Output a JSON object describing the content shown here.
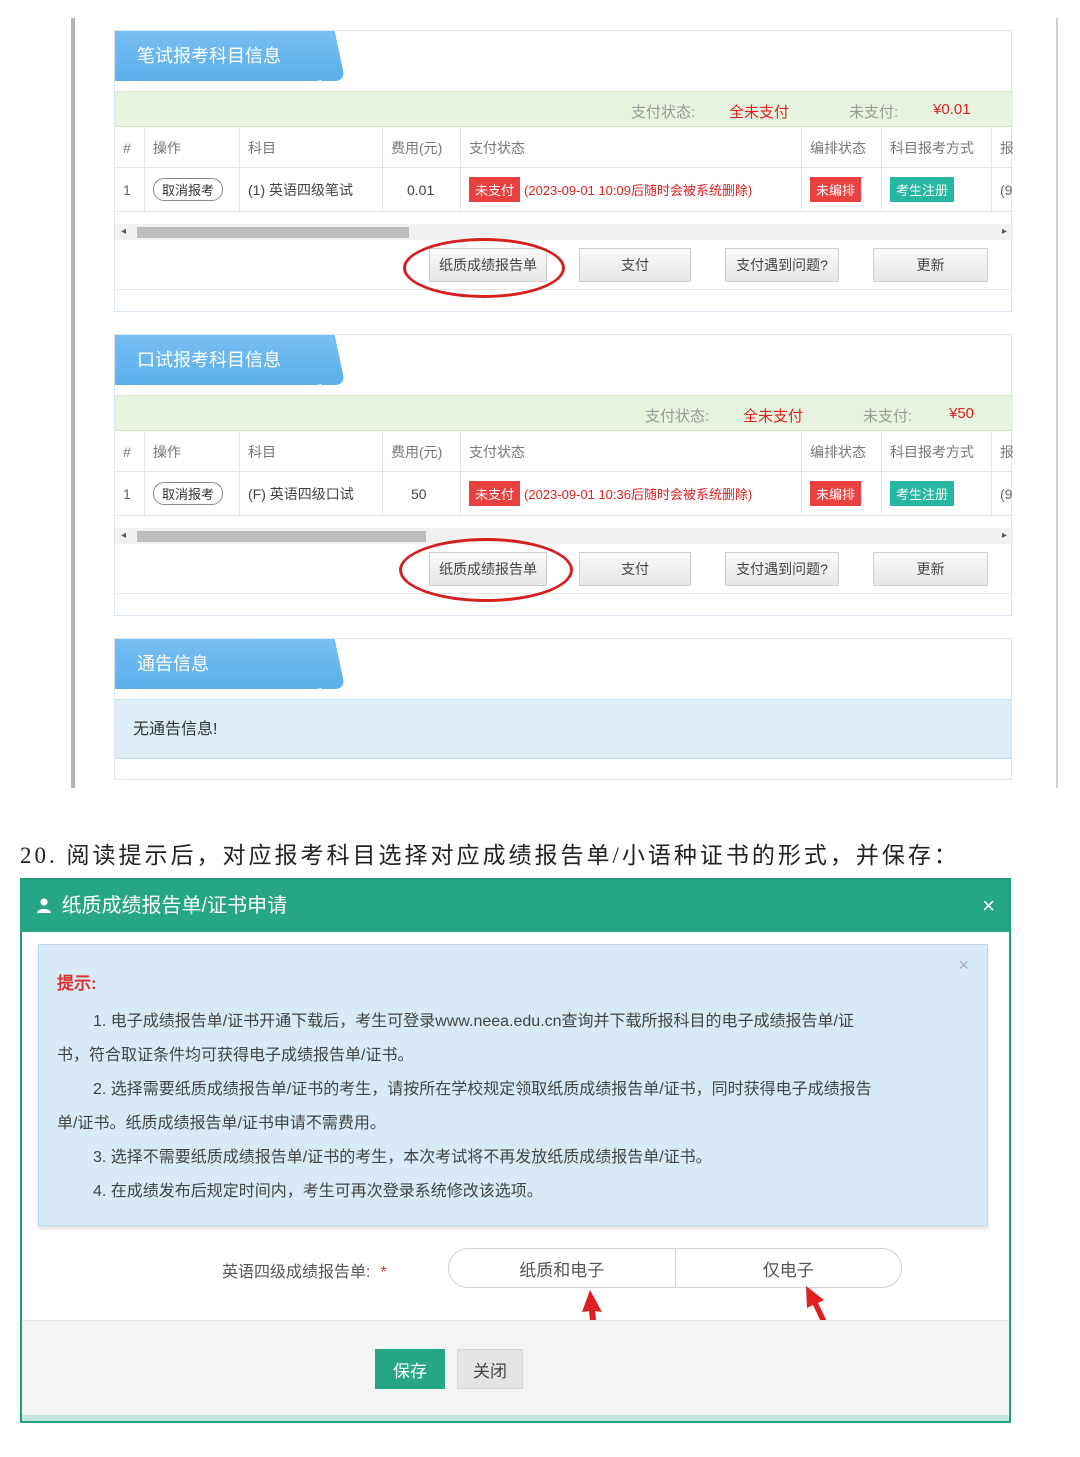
{
  "written_panel": {
    "title": "笔试报考科目信息",
    "pay_status_label": "支付状态:",
    "pay_status_value": "全未支付",
    "unpaid_label": "未支付:",
    "unpaid_value": "¥0.01",
    "columns": [
      "#",
      "操作",
      "科目",
      "费用(元)",
      "支付状态",
      "编排状态",
      "科目报考方式",
      "报"
    ],
    "row": {
      "index": "1",
      "action": "取消报考",
      "subject": "(1) 英语四级笔试",
      "fee": "0.01",
      "pay_tag": "未支付",
      "pay_note": "(2023-09-01 10:09后随时会被系统删除)",
      "arrange": "未编排",
      "mode": "考生注册",
      "extra": "(9"
    },
    "scroll_thumb_fraction": 0.31,
    "buttons": [
      "纸质成绩报告单",
      "支付",
      "支付遇到问题?",
      "更新"
    ]
  },
  "oral_panel": {
    "title": "口试报考科目信息",
    "pay_status_label": "支付状态:",
    "pay_status_value": "全未支付",
    "unpaid_label": "未支付:",
    "unpaid_value": "¥50",
    "columns": [
      "#",
      "操作",
      "科目",
      "费用(元)",
      "支付状态",
      "编排状态",
      "科目报考方式",
      "报"
    ],
    "row": {
      "index": "1",
      "action": "取消报考",
      "subject": "(F) 英语四级口试",
      "fee": "50",
      "pay_tag": "未支付",
      "pay_note": "(2023-09-01 10:36后随时会被系统删除)",
      "arrange": "未编排",
      "mode": "考生注册",
      "extra": "(9"
    },
    "scroll_thumb_fraction": 0.33,
    "buttons": [
      "纸质成绩报告单",
      "支付",
      "支付遇到问题?",
      "更新"
    ]
  },
  "notice_panel": {
    "title": "通告信息",
    "body": "无通告信息!"
  },
  "instruction": "20. 阅读提示后，对应报考科目选择对应成绩报告单/小语种证书的形式，并保存：",
  "dialog": {
    "title": "纸质成绩报告单/证书申请",
    "close": "×",
    "tip_close": "×",
    "tip_title": "提示:",
    "tip_lines": [
      "1. 电子成绩报告单/证书开通下载后，考生可登录www.neea.edu.cn查询并下载所报科目的电子成绩报告单/证",
      "书，符合取证条件均可获得电子成绩报告单/证书。",
      "2. 选择需要纸质成绩报告单/证书的考生，请按所在学校规定领取纸质成绩报告单/证书，同时获得电子成绩报告",
      "单/证书。纸质成绩报告单/证书申请不需费用。",
      "3. 选择不需要纸质成绩报告单/证书的考生，本次考试将不再发放纸质成绩报告单/证书。",
      "4. 在成绩发布后规定时间内，考生可再次登录系统修改该选项。"
    ],
    "field_label": "英语四级成绩报告单:",
    "required_mark": "*",
    "options": [
      "纸质和电子",
      "仅电子"
    ],
    "save": "保存",
    "close_btn": "关闭"
  },
  "colors": {
    "tab_blue": "#5aaeea",
    "dialog_green": "#26a685",
    "alert_red": "#e02020",
    "annotation_red": "#d42020"
  }
}
